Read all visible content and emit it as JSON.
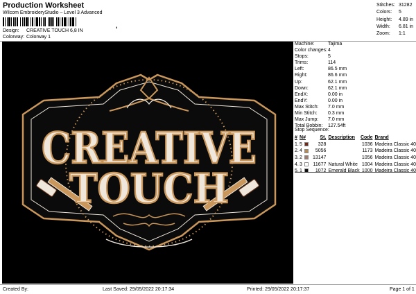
{
  "header": {
    "title": "Production Worksheet",
    "subtitle": "Wilcom EmbroideryStudio – Level 3 Advanced",
    "barcode_suffix": ","
  },
  "meta": {
    "design_label": "Design:",
    "design_value": "CREATIVE TOUCH 6,8 IN",
    "colorway_label": "Colorway:",
    "colorway_value": "Colorway 1"
  },
  "top_stats": [
    {
      "label": "Stitches:",
      "value": "31282"
    },
    {
      "label": "Colors:",
      "value": "5"
    },
    {
      "label": "Height:",
      "value": "4.89 in"
    },
    {
      "label": "Width:",
      "value": "6.81 in"
    },
    {
      "label": "Zoom:",
      "value": "1:1"
    }
  ],
  "machine_stats": [
    {
      "label": "Machine:",
      "value": "Tajima"
    },
    {
      "label": "Color changes:",
      "value": "4"
    },
    {
      "label": "Stops:",
      "value": "5"
    },
    {
      "label": "Trims:",
      "value": "114"
    },
    {
      "label": "Left:",
      "value": "86.5 mm"
    },
    {
      "label": "Right:",
      "value": "86.6 mm"
    },
    {
      "label": "Up:",
      "value": "62.1 mm"
    },
    {
      "label": "Down:",
      "value": "62.1 mm"
    },
    {
      "label": "EndX:",
      "value": "0.00 in"
    },
    {
      "label": "EndY:",
      "value": "0.00 in"
    },
    {
      "label": "Max Stitch:",
      "value": "7.0 mm"
    },
    {
      "label": "Min Stitch:",
      "value": "0.3 mm"
    },
    {
      "label": "Max Jump:",
      "value": "7.0 mm"
    },
    {
      "label": "Total Bobbin:",
      "value": "127.54ft"
    }
  ],
  "stop_sequence": {
    "heading": "Stop Sequence:",
    "columns": [
      "#",
      "N#",
      "St.",
      "Description",
      "Code",
      "Brand"
    ],
    "rows": [
      {
        "num": "1.",
        "n": "5",
        "color": "#6b2a1c",
        "st": "328",
        "desc": "",
        "code": "1036",
        "brand": "Madeira Classic 40"
      },
      {
        "num": "2.",
        "n": "4",
        "color": "#b38a5a",
        "st": "5056",
        "desc": "",
        "code": "1173",
        "brand": "Madeira Classic 40"
      },
      {
        "num": "3.",
        "n": "2",
        "color": "#a07a6e",
        "st": "13147",
        "desc": "",
        "code": "1056",
        "brand": "Madeira Classic 40"
      },
      {
        "num": "4.",
        "n": "3",
        "color": "#ffffff",
        "st": "11677",
        "desc": "Natural White",
        "code": "1004",
        "brand": "Madeira Classic 40"
      },
      {
        "num": "5.",
        "n": "1",
        "color": "#111111",
        "st": "1072",
        "desc": "Emerald Black",
        "code": "1000",
        "brand": "Madeira Classic 40"
      }
    ]
  },
  "design_art": {
    "line1": "CREATIVE",
    "line2": "TOUCH",
    "colors": {
      "gold": "#c9975b",
      "cream": "#efe7dc",
      "brown": "#6b3a22",
      "bg": "#000000"
    }
  },
  "footer": {
    "created_by": "Created By:",
    "last_saved": "Last Saved: 29/05/2022 20:17:34",
    "printed": "Printed: 29/05/2022 20:17:37",
    "page": "Page 1 of 1"
  }
}
